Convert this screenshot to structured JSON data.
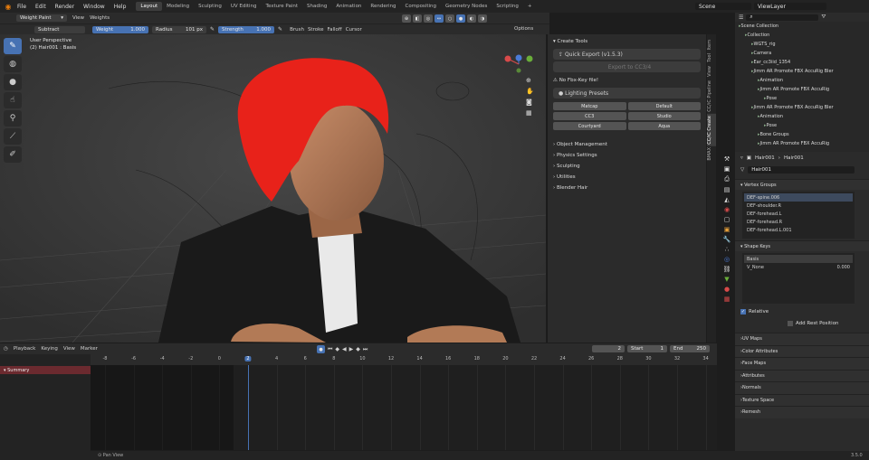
{
  "menubar": {
    "items": [
      "File",
      "Edit",
      "Render",
      "Window",
      "Help"
    ],
    "workspaces": [
      "Layout",
      "Modeling",
      "Sculpting",
      "UV Editing",
      "Texture Paint",
      "Shading",
      "Animation",
      "Rendering",
      "Compositing",
      "Geometry Nodes",
      "Scripting"
    ],
    "scene": "Scene",
    "viewlayer": "ViewLayer"
  },
  "header": {
    "mode": "Weight Paint",
    "menus": [
      "View",
      "Weights"
    ]
  },
  "toolsettings": {
    "blend": "Subtract",
    "weight_label": "Weight",
    "weight_value": "1.000",
    "radius_label": "Radius",
    "radius_value": "101 px",
    "strength_label": "Strength",
    "strength_value": "1.000",
    "menus": [
      "Brush",
      "Stroke",
      "Falloff",
      "Cursor"
    ],
    "options": "Options"
  },
  "viewport": {
    "perspective": "User Perspective",
    "object": "(2) Hair001 : Basis"
  },
  "npanel": {
    "create_tools": "Create Tools",
    "quick_export": "Quick Export  (v1.5.3)",
    "export_cc": "Export to CC3/4",
    "fbx_key": "No Fbx-Key file!",
    "lighting": "Lighting Presets",
    "presets": [
      "Matcap",
      "Default",
      "CC3",
      "Studio",
      "Courtyard",
      "Aqua"
    ],
    "sections": [
      "Object Management",
      "Physics Settings",
      "Sculpting",
      "Utilities",
      "Blender Hair"
    ]
  },
  "vtabs": [
    "Item",
    "Tool",
    "View",
    "CC/iC Pipeline",
    "CC/iC Create",
    "BMAX"
  ],
  "outliner": {
    "rows": [
      {
        "indent": 0,
        "label": "Scene Collection"
      },
      {
        "indent": 1,
        "label": "Collection"
      },
      {
        "indent": 2,
        "label": "WGTS_rig"
      },
      {
        "indent": 2,
        "label": "Camera"
      },
      {
        "indent": 2,
        "label": "Ear_cc3iid_1354"
      },
      {
        "indent": 2,
        "label": "Jimm AR Promote FBX AccuRig Bler"
      },
      {
        "indent": 3,
        "label": "Animation"
      },
      {
        "indent": 3,
        "label": "Jimm AR Promote FBX AccuRig"
      },
      {
        "indent": 4,
        "label": "Pose"
      },
      {
        "indent": 2,
        "label": "Jimm AR Promote FBX AccuRig Bler"
      },
      {
        "indent": 3,
        "label": "Animation"
      },
      {
        "indent": 4,
        "label": "Pose"
      },
      {
        "indent": 3,
        "label": "Bone Groups"
      },
      {
        "indent": 3,
        "label": "Jimm AR Promote FBX AccuRig"
      }
    ]
  },
  "properties": {
    "breadcrumb_a": "Hair001",
    "breadcrumb_b": "Hair001",
    "mesh_name": "Hair001",
    "vertex_groups_title": "Vertex Groups",
    "vertex_groups": [
      "DEF-spine.006",
      "DEF-shoulder.R",
      "DEF-forehead.L",
      "DEF-forehead.R",
      "DEF-forehead.L.001"
    ],
    "shape_keys_title": "Shape Keys",
    "shape_keys": [
      {
        "name": "Basis",
        "value": ""
      },
      {
        "name": "V_None",
        "value": "0.000"
      }
    ],
    "relative": "Relative",
    "add_rest": "Add Rest Position",
    "sections": [
      "UV Maps",
      "Color Attributes",
      "Face Maps",
      "Attributes",
      "Normals",
      "Texture Space",
      "Remesh"
    ]
  },
  "timeline": {
    "menus": [
      "Playback",
      "Keying",
      "View",
      "Marker"
    ],
    "current": "2",
    "start_label": "Start",
    "start": "1",
    "end_label": "End",
    "end": "250",
    "ticks": [
      "-8",
      "-6",
      "-4",
      "-2",
      "0",
      "2",
      "4",
      "6",
      "8",
      "10",
      "12",
      "14",
      "16",
      "18",
      "20",
      "22",
      "24",
      "26",
      "28",
      "30",
      "32",
      "34"
    ],
    "summary": "Summary",
    "status_hint": "Pan View",
    "version": "3.5.0"
  },
  "colors": {
    "accent": "#4772b3",
    "hair": "#e8221a"
  }
}
